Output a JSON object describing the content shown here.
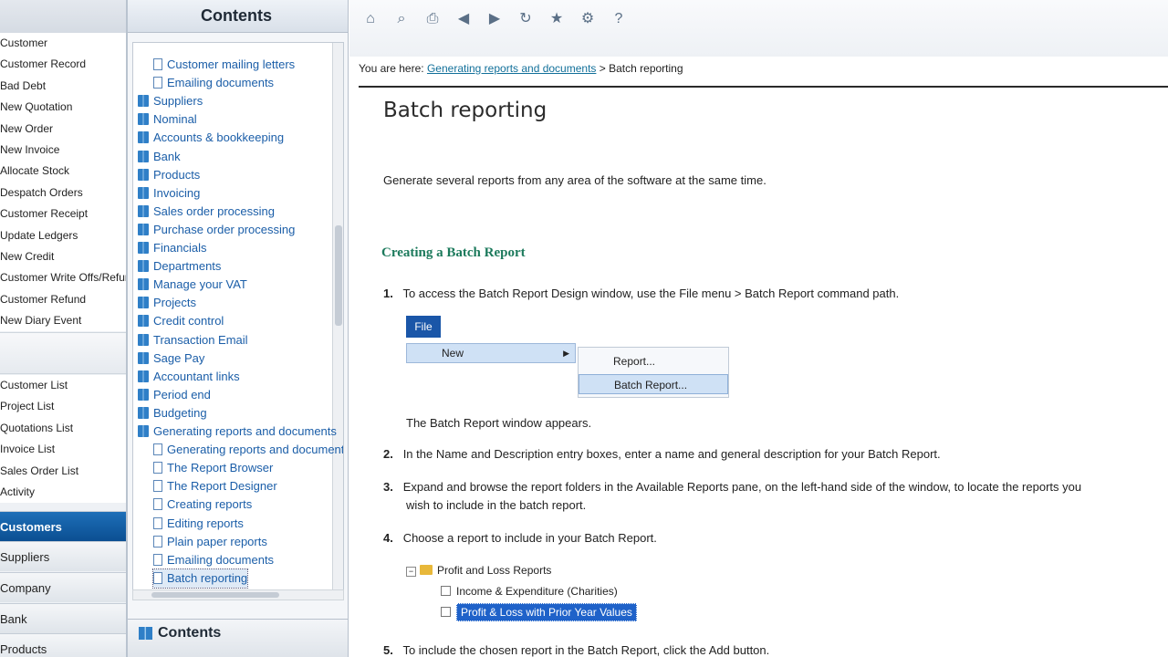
{
  "left_pane": {
    "tasks_top": [
      "Customer",
      "Customer Record",
      "Bad Debt",
      "New Quotation",
      "New Order",
      "New Invoice",
      "Allocate Stock",
      "Despatch Orders",
      "Customer Receipt",
      "Update Ledgers",
      "New Credit",
      "Customer Write Offs/Refunds",
      "Customer Refund",
      "New Diary Event"
    ],
    "tasks_bottom": [
      "Customer List",
      "Project List",
      "Quotations List",
      "Invoice List",
      "Sales Order List",
      "Activity"
    ],
    "modules": [
      "Customers",
      "Suppliers",
      "Company",
      "Bank",
      "Products"
    ]
  },
  "contents_pane": {
    "header_title": "Contents",
    "footer_title": "Contents",
    "toc": [
      {
        "label": "Customer mailing letters",
        "kind": "page",
        "level": 1
      },
      {
        "label": "Emailing documents",
        "kind": "page",
        "level": 1
      },
      {
        "label": "Suppliers",
        "kind": "book",
        "level": 0
      },
      {
        "label": "Nominal",
        "kind": "book",
        "level": 0
      },
      {
        "label": "Accounts & bookkeeping",
        "kind": "book",
        "level": 0
      },
      {
        "label": "Bank",
        "kind": "book",
        "level": 0
      },
      {
        "label": "Products",
        "kind": "book",
        "level": 0
      },
      {
        "label": "Invoicing",
        "kind": "book",
        "level": 0
      },
      {
        "label": "Sales order processing",
        "kind": "book",
        "level": 0
      },
      {
        "label": "Purchase order processing",
        "kind": "book",
        "level": 0
      },
      {
        "label": "Financials",
        "kind": "book",
        "level": 0
      },
      {
        "label": "Departments",
        "kind": "book",
        "level": 0
      },
      {
        "label": "Manage your VAT",
        "kind": "book",
        "level": 0
      },
      {
        "label": "Projects",
        "kind": "book",
        "level": 0
      },
      {
        "label": "Credit control",
        "kind": "book",
        "level": 0
      },
      {
        "label": "Transaction Email",
        "kind": "book",
        "level": 0
      },
      {
        "label": "Sage Pay",
        "kind": "book",
        "level": 0
      },
      {
        "label": "Accountant links",
        "kind": "book",
        "level": 0
      },
      {
        "label": "Period end",
        "kind": "book",
        "level": 0
      },
      {
        "label": "Budgeting",
        "kind": "book",
        "level": 0
      },
      {
        "label": "Generating reports and documents",
        "kind": "book",
        "level": 0
      },
      {
        "label": "Generating reports and documents",
        "kind": "page",
        "level": 1
      },
      {
        "label": "The Report Browser",
        "kind": "page",
        "level": 1
      },
      {
        "label": "The Report Designer",
        "kind": "page",
        "level": 1
      },
      {
        "label": "Creating reports",
        "kind": "page",
        "level": 1
      },
      {
        "label": "Editing reports",
        "kind": "page",
        "level": 1
      },
      {
        "label": "Plain paper reports",
        "kind": "page",
        "level": 1
      },
      {
        "label": "Emailing documents",
        "kind": "page",
        "level": 1
      },
      {
        "label": "Batch reporting",
        "kind": "page",
        "level": 1
      }
    ]
  },
  "toolbar": {
    "icons": [
      "home-icon",
      "search-icon",
      "print-icon",
      "back-icon",
      "forward-icon",
      "refresh-icon",
      "favorites-icon",
      "options-icon",
      "help-icon"
    ],
    "glyphs": [
      "⌂",
      "⌕",
      "⎙",
      "◀",
      "▶",
      "↻",
      "★",
      "⚙",
      "?"
    ]
  },
  "article": {
    "breadcrumb_prefix": "You are here:",
    "breadcrumb_link": "Generating reports and documents",
    "breadcrumb_sep": ">",
    "breadcrumb_current": "Batch reporting",
    "title": "Batch reporting",
    "intro": "Generate several reports from any area of the software at the same time.",
    "section_heading": "Creating a Batch Report",
    "step1_num": "1.",
    "step1_text": "To access the Batch Report Design window, use the File menu > Batch Report command path.",
    "menu_file": "File",
    "menu_new": "New",
    "menu_report": "Report...",
    "menu_batch": "Batch Report...",
    "window_appears": "The Batch Report window appears.",
    "step2_num": "2.",
    "step2_text": "In the Name and Description entry boxes, enter a name and general description for your Batch Report.",
    "step3_num": "3.",
    "step3_text_a": "Expand and browse the report folders in the Available Reports pane, on the left-hand side of the window, to locate the reports you",
    "step3_text_b": "wish to include in the batch report.",
    "step4_num": "4.",
    "step4_text": "Choose a report to include in your Batch Report.",
    "tree_folder": "Profit and Loss Reports",
    "tree_item1": "Income & Expenditure (Charities)",
    "tree_item2": "Profit & Loss with Prior Year Values",
    "step5_num": "5.",
    "step5_text": "To include the chosen report in the Batch Report, click the Add button."
  }
}
